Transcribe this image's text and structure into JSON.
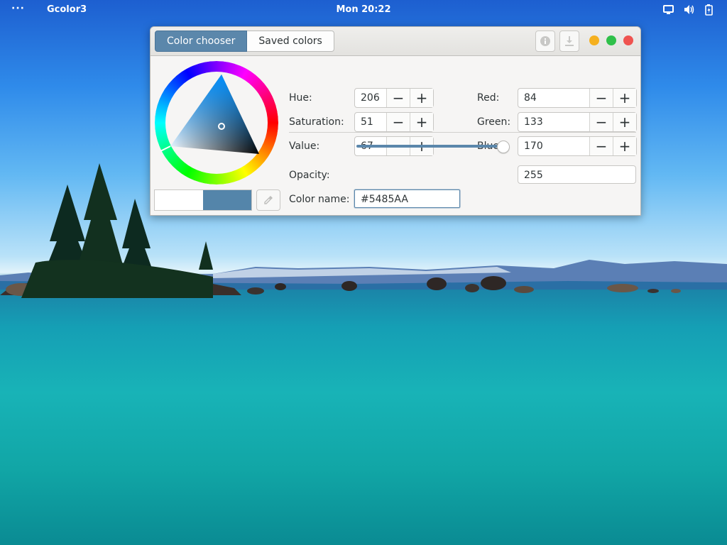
{
  "topbar": {
    "activities": "···",
    "app_name": "Gcolor3",
    "clock": "Mon 20:22",
    "tray_icons": [
      "screen-icon",
      "volume-icon",
      "battery-icon"
    ]
  },
  "window": {
    "tabs": [
      {
        "label": "Color chooser",
        "active": true
      },
      {
        "label": "Saved colors",
        "active": false
      }
    ],
    "toolbar_icons": [
      "info-icon",
      "save-icon"
    ],
    "window_controls": {
      "minimize": "#f5b01f",
      "maximize": "#2fc04a",
      "close": "#ef5350"
    }
  },
  "chooser": {
    "hsv": {
      "hue": {
        "label": "Hue:",
        "value": "206"
      },
      "saturation": {
        "label": "Saturation:",
        "value": "51"
      },
      "value": {
        "label": "Value:",
        "value": "67"
      }
    },
    "rgb": {
      "red": {
        "label": "Red:",
        "value": "84"
      },
      "green": {
        "label": "Green:",
        "value": "133"
      },
      "blue": {
        "label": "Blue:",
        "value": "170"
      }
    },
    "opacity": {
      "label": "Opacity:",
      "value": "255",
      "fraction": 1.0
    },
    "color_name": {
      "label": "Color name:",
      "value": "#5485AA"
    },
    "minus_glyph": "−",
    "plus_glyph": "+",
    "swatch": {
      "previous": "#ffffff",
      "current": "#5485AA"
    },
    "picker_icon": "eyedropper-icon"
  },
  "colors": {
    "accent": "#5b87ab",
    "selected": "#5485AA"
  }
}
